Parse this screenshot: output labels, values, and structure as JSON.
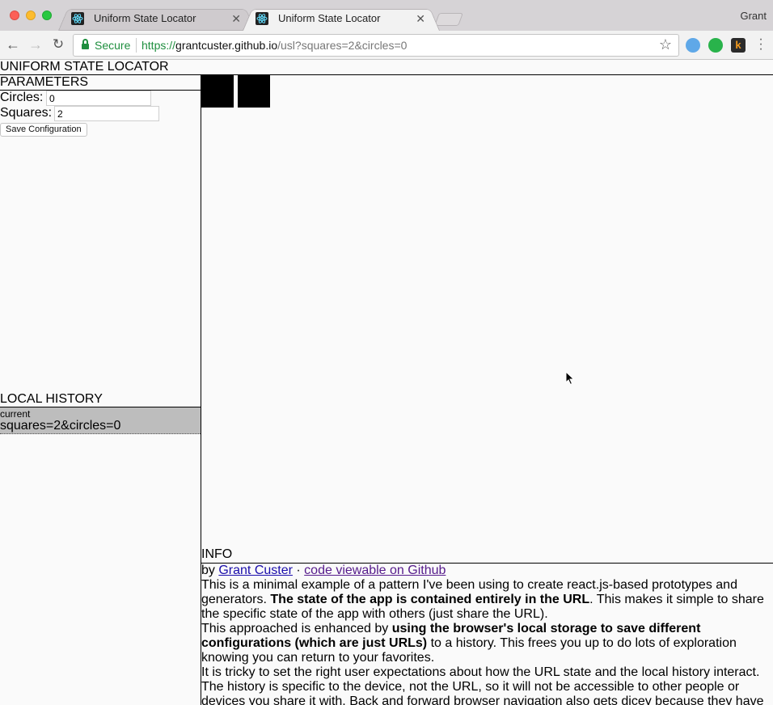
{
  "browser": {
    "tabs": [
      {
        "title": "Uniform State Locator",
        "active": false
      },
      {
        "title": "Uniform State Locator",
        "active": true
      }
    ],
    "profile_name": "Grant",
    "secure_label": "Secure",
    "url_scheme": "https://",
    "url_host": "grantcuster.github.io",
    "url_path": "/usl?squares=2&circles=0"
  },
  "app": {
    "title": "UNIFORM STATE LOCATOR",
    "parameters": {
      "heading": "PARAMETERS",
      "circles_label": "Circles:",
      "circles_value": "0",
      "squares_label": "Squares:",
      "squares_value": "2",
      "save_label": "Save Configuration"
    },
    "history": {
      "heading": "LOCAL HISTORY",
      "items": [
        {
          "label": "current",
          "value": "squares=2&circles=0"
        }
      ]
    },
    "canvas": {
      "squares": 2,
      "circles": 0
    },
    "info": {
      "heading": "INFO",
      "by": "by",
      "author": "Grant Custer",
      "sep": " · ",
      "code_link": "code viewable on Github",
      "p1a": "This is a minimal example of a pattern I've been using to create react.js-based prototypes and generators. ",
      "p1b": "The state of the app is contained entirely in the URL",
      "p1c": ". This makes it simple to share the specific state of the app with others (just share the URL).",
      "p2a": "This approached is enhanced by ",
      "p2b": "using the browser's local storage to save different configurations (which are just URLs)",
      "p2c": " to a history. This frees you up to do lots of exploration knowing you can return to your favorites.",
      "p3": "It is tricky to set the right user expectations about how the URL state and the local history interact. The history is specific to the device, not the URL, so it will not be accessible to other people or devices you share it with. Back and forward browser navigation also gets dicey because they have"
    }
  }
}
